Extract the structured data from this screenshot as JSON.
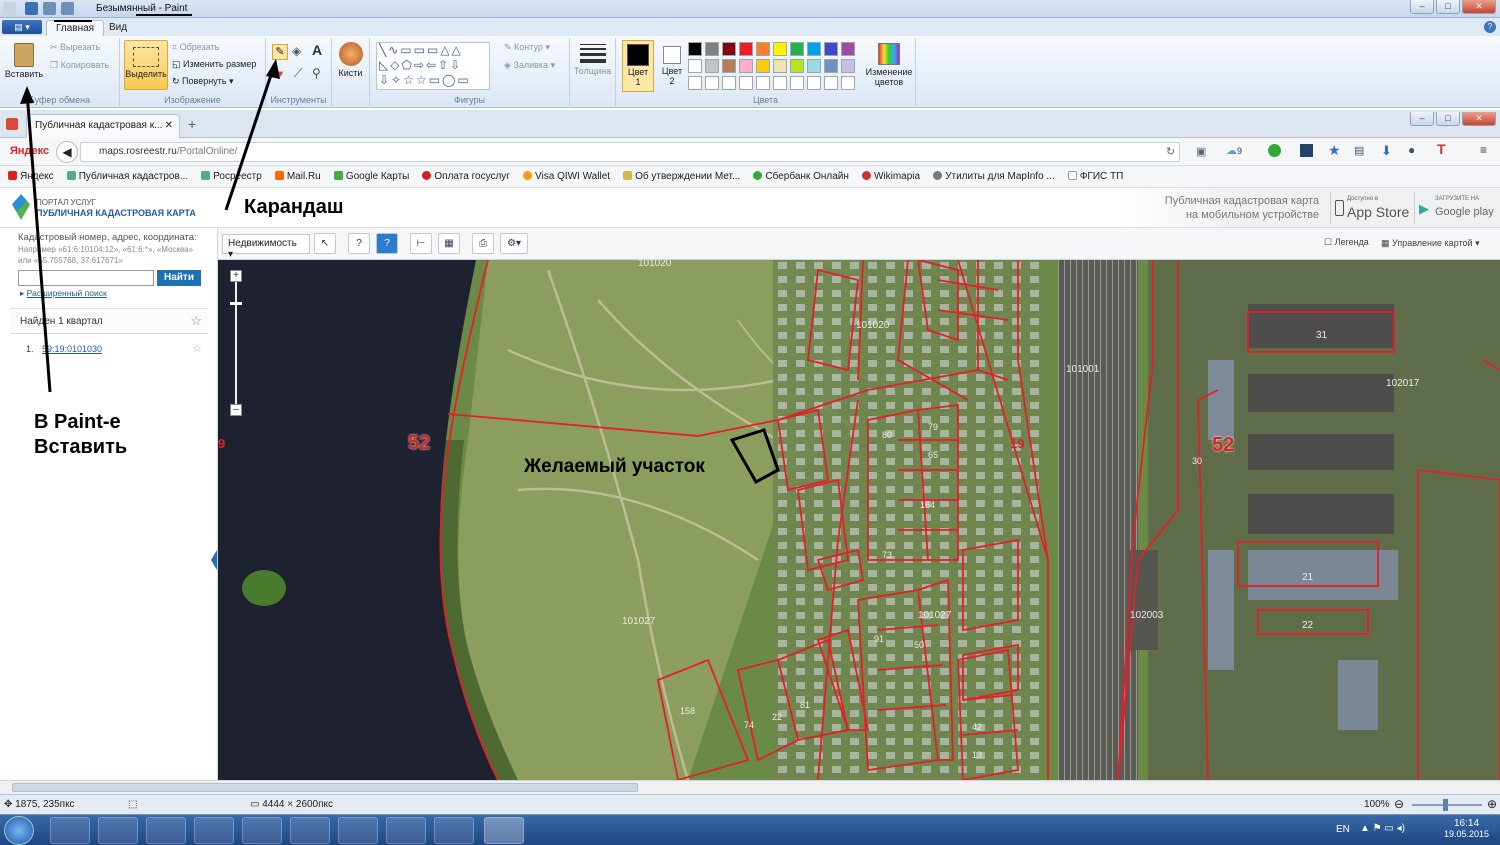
{
  "paint": {
    "window_title": "Безымянный - Paint",
    "tabs": [
      "Главная",
      "Вид"
    ],
    "clipboard": {
      "paste": "Вставить",
      "cut": "Вырезать",
      "copy": "Копировать",
      "label": "Буфер обмена"
    },
    "image": {
      "select": "Выделить",
      "crop": "Обрезать",
      "resize": "Изменить размер",
      "rotate": "Повернуть",
      "label": "Изображение"
    },
    "tools": {
      "label": "Инструменты"
    },
    "brushes": "Кисти",
    "shapes": {
      "outline": "Контур",
      "fill": "Заливка",
      "label": "Фигуры"
    },
    "thickness": "Толщина",
    "color1": [
      "Цвет",
      "1"
    ],
    "color2": [
      "Цвет",
      "2"
    ],
    "edit_colors": [
      "Изменение",
      "цветов"
    ],
    "colors_label": "Цвета",
    "palette_row1": [
      "#000000",
      "#7f7f7f",
      "#880015",
      "#ed1c24",
      "#ff7f27",
      "#fff200",
      "#22b14c",
      "#00a2e8",
      "#3f48cc",
      "#a349a4"
    ],
    "palette_row2": [
      "#ffffff",
      "#c3c3c3",
      "#b97a57",
      "#ffaec9",
      "#ffc90e",
      "#efe4b0",
      "#b5e61d",
      "#99d9ea",
      "#7092be",
      "#c8bfe7"
    ]
  },
  "browser": {
    "tab_title": "Публичная кадастровая к...",
    "url_host": "maps.rosreestr.ru",
    "url_path": "/PortalOnline/",
    "yandex": "Яндекс",
    "cloud_count": "9",
    "bookmarks": [
      "Яндекс",
      "Публичная кадастров...",
      "Росреестр",
      "Mail.Ru",
      "Google Карты",
      "Оплата госуслуг",
      "Visa QIWI Wallet",
      "Об утверждении Мет...",
      "Сбербанк Онлайн",
      "Wikimapia",
      "Утилиты для MapInfo ...",
      "ФГИС ТП"
    ]
  },
  "portal": {
    "line1": "ПОРТАЛ УСЛУГ",
    "line2": "ПУБЛИЧНАЯ КАДАСТРОВАЯ КАРТА",
    "mobile_line1": "Публичная кадастровая карта",
    "mobile_line2": "на мобильном устройстве",
    "appstore_small": "Доступно в",
    "appstore": "App Store",
    "googleplay_small": "ЗАГРУЗИТЕ НА",
    "googleplay": "Google play"
  },
  "sidebar": {
    "search_label": "Кадастровый номер, адрес, координата:",
    "search_hint": "Например «61:6:10104:12», «61:6:*», «Москва» или «55.755768, 37.617671»",
    "search_button": "Найти",
    "advanced": "Расширенный поиск",
    "found": "Найден 1 квартал",
    "result_num": "1.",
    "result": "59:19:0101030"
  },
  "map_toolbar": {
    "dropdown": "Недвижимость",
    "legend": "Легенда",
    "manage": "Управление картой"
  },
  "map_labels": [
    "101020",
    "101020",
    "101001",
    "102017",
    "52",
    "52",
    "9",
    "19",
    "30",
    "101027",
    "101027",
    "102003",
    "31",
    "21",
    "22",
    "80",
    "79",
    "65",
    "73",
    "164",
    "158",
    "74",
    "22",
    "81",
    "50",
    "91",
    "42",
    "13"
  ],
  "annotations": {
    "pencil": "Карандаш",
    "paste_line1": "В Paint-е",
    "paste_line2": "Вставить",
    "desired": "Желаемый участок"
  },
  "status": {
    "coords": "1875, 235пкс",
    "size": "4444 × 2600пкс",
    "zoom": "100%"
  },
  "taskbar": {
    "lang": "EN",
    "time": "16:14",
    "date": "19.05.2015"
  }
}
